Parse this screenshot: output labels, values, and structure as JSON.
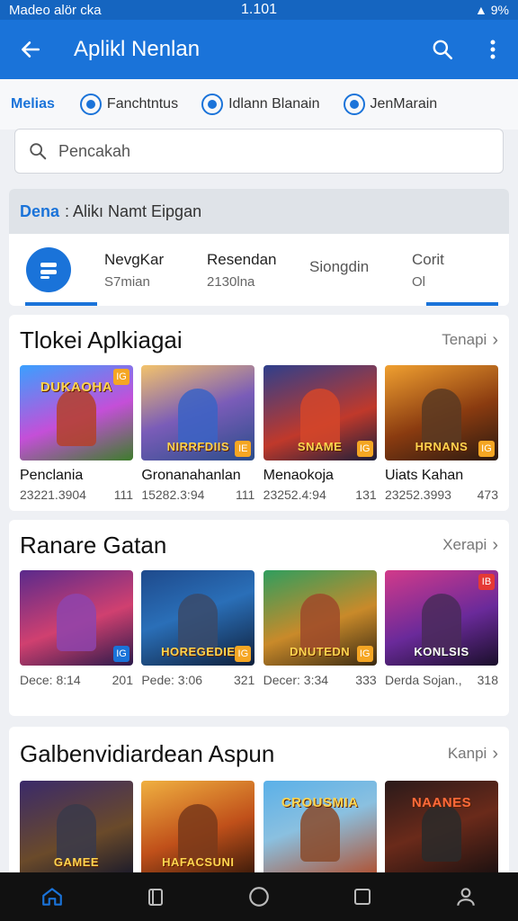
{
  "status_bar": {
    "left": "Madeo alör cka",
    "time": "1.101",
    "right": "9%"
  },
  "app_bar": {
    "title": "Aplikl Nenlan"
  },
  "chips": [
    {
      "label": "Melias",
      "active": true
    },
    {
      "label": "Fanchtntus",
      "icon": "app-icon"
    },
    {
      "label": "Idlann  Blanain",
      "icon": "app-icon"
    },
    {
      "label": "JenMarain",
      "icon": "app-icon"
    }
  ],
  "search": {
    "placeholder": "Pencakah"
  },
  "promo": {
    "header_bold": "Dena",
    "header_text": ": Alikı Namt Eipgan",
    "stats": [
      {
        "label": "NevgKar",
        "value": "S7mian"
      },
      {
        "label": "Resendan",
        "value": "2130lna"
      },
      {
        "label": "Siongdin",
        "value": ""
      },
      {
        "label": "Corit",
        "value": "Ol"
      }
    ]
  },
  "sections": [
    {
      "title": "Tlokei Aplkiagai",
      "see_all": "Tenapi",
      "cards": [
        {
          "name": "Penclania",
          "meta_left": "23221.3904",
          "meta_right": "111",
          "banner": "DUKAOHA",
          "badge": "IG"
        },
        {
          "name": "Gronanahanlan",
          "meta_left": "15282.3:94",
          "meta_right": "111",
          "banner": "NIRRFDIIS",
          "badge": "IE"
        },
        {
          "name": "Menaokoja",
          "meta_left": "23252.4:94",
          "meta_right": "131",
          "banner": "SNAME",
          "badge": "IG"
        },
        {
          "name": "Uiats Kahan",
          "meta_left": "23252.3993",
          "meta_right": "473",
          "banner": "HRNANS",
          "badge": "IG"
        }
      ]
    },
    {
      "title": "Ranare Gatan",
      "see_all": "Xerapi",
      "cards": [
        {
          "name": "Dece: 8:14",
          "meta_left": "",
          "meta_right": "201",
          "banner": "",
          "badge": "IG"
        },
        {
          "name": "Pede: 3:06",
          "meta_left": "",
          "meta_right": "321",
          "banner": "HOREGEDIE",
          "badge": "IG"
        },
        {
          "name": "Decer: 3:34",
          "meta_left": "",
          "meta_right": "333",
          "banner": "DNUTEDN",
          "badge": "IG"
        },
        {
          "name": "Derda Sojan.,",
          "meta_left": "",
          "meta_right": "318",
          "banner": "KONLSIS",
          "badge": "IB"
        }
      ]
    },
    {
      "title": "Galbenvidiardean Aspun",
      "see_all": "Kanpi",
      "cards": [
        {
          "banner": "GAMEE"
        },
        {
          "banner": "HAFACSUNI"
        },
        {
          "banner": "CROUSMIA"
        },
        {
          "banner": "NAANES"
        }
      ]
    }
  ],
  "colors": {
    "primary": "#1a73d9",
    "status": "#1565c0",
    "nav": "#111111"
  }
}
